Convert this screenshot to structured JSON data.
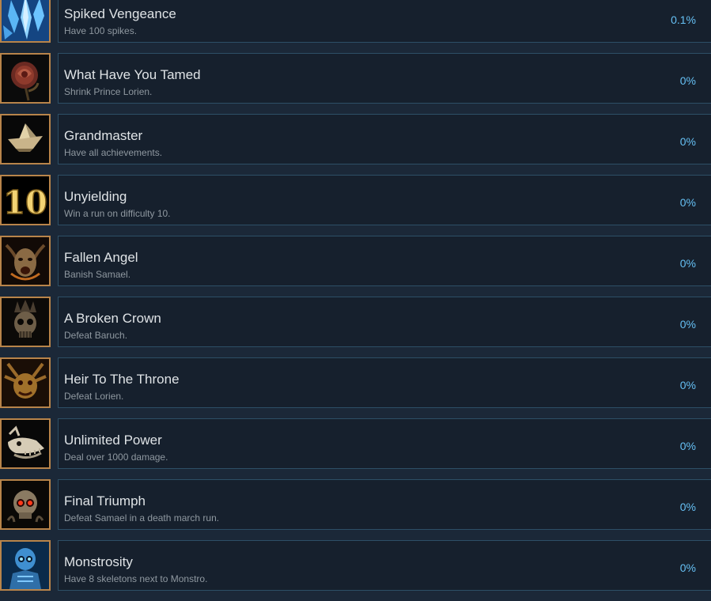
{
  "achievements": [
    {
      "title": "Spiked Vengeance",
      "description": "Have 100 spikes.",
      "percent": "0.1%",
      "icon": "ice-shard-icon"
    },
    {
      "title": "What Have You Tamed",
      "description": "Shrink Prince Lorien.",
      "percent": "0%",
      "icon": "rose-icon"
    },
    {
      "title": "Grandmaster",
      "description": "Have all achievements.",
      "percent": "0%",
      "icon": "paper-boat-icon"
    },
    {
      "title": "Unyielding",
      "description": "Win a run on difficulty 10.",
      "percent": "0%",
      "icon": "difficulty-ten-icon",
      "icon_text": "10"
    },
    {
      "title": "Fallen Angel",
      "description": "Banish Samael.",
      "percent": "0%",
      "icon": "demon-face-icon"
    },
    {
      "title": "A Broken Crown",
      "description": "Defeat Baruch.",
      "percent": "0%",
      "icon": "crowned-skull-icon"
    },
    {
      "title": "Heir To The Throne",
      "description": "Defeat Lorien.",
      "percent": "0%",
      "icon": "horned-demon-icon"
    },
    {
      "title": "Unlimited Power",
      "description": "Deal over 1000 damage.",
      "percent": "0%",
      "icon": "beast-skull-icon"
    },
    {
      "title": "Final Triumph",
      "description": "Defeat Samael in a death march run.",
      "percent": "0%",
      "icon": "red-eyed-skull-icon"
    },
    {
      "title": "Monstrosity",
      "description": "Have 8 skeletons next to Monstro.",
      "percent": "0%",
      "icon": "blue-skeleton-icon"
    }
  ],
  "colors": {
    "background": "#1b2838",
    "row_panel": "#16202d",
    "row_border": "#2d4f66",
    "icon_border": "#b8844a",
    "title": "#dfe3e6",
    "description": "#8f98a0",
    "percent": "#66c0f4"
  }
}
